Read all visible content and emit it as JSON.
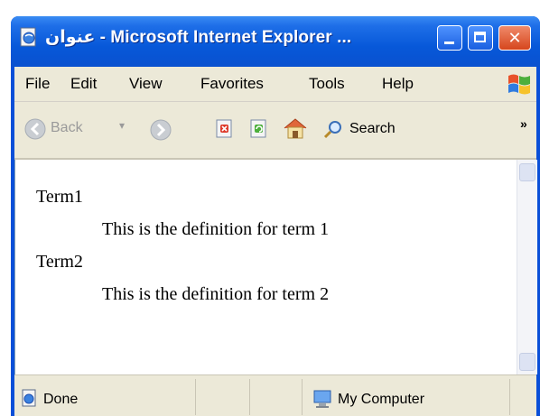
{
  "window": {
    "title": "عنوان - Microsoft Internet Explorer ..."
  },
  "menubar": {
    "items": [
      "File",
      "Edit",
      "View",
      "Favorites",
      "Tools",
      "Help"
    ]
  },
  "toolbar": {
    "back_label": "Back",
    "search_label": "Search",
    "overflow": "»"
  },
  "content": {
    "terms": [
      {
        "term": "Term1",
        "definition": "This is the definition for term 1"
      },
      {
        "term": "Term2",
        "definition": "This is the definition for term 2"
      }
    ]
  },
  "statusbar": {
    "status": "Done",
    "zone": "My Computer"
  },
  "colors": {
    "titlebar": "#0758d9",
    "chrome": "#ece9d8",
    "close_button": "#d6461d"
  }
}
